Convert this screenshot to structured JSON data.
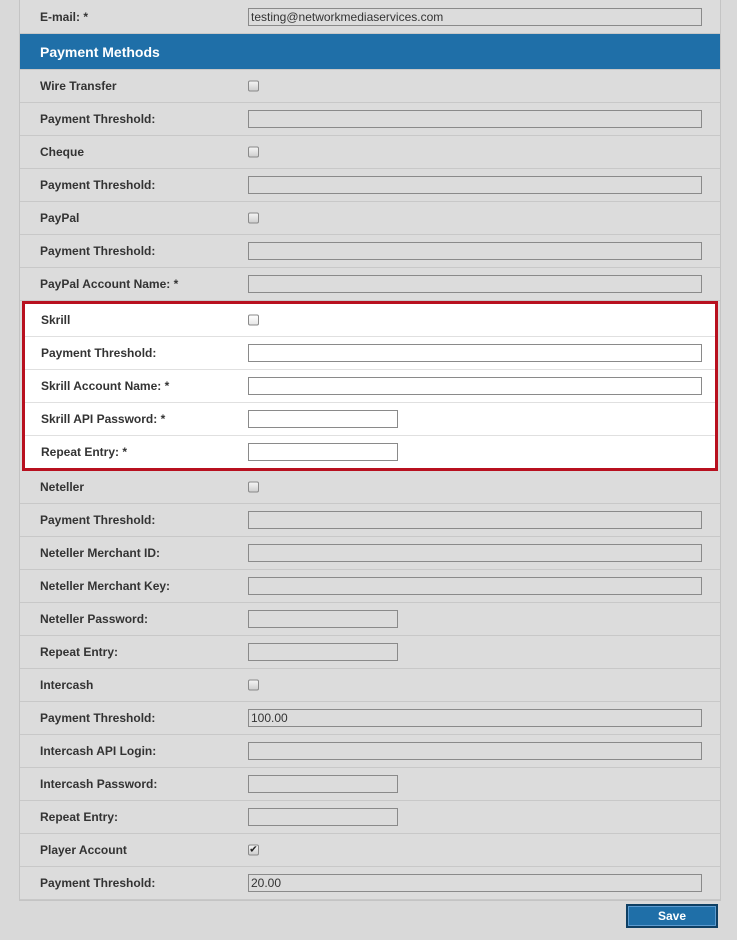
{
  "email": {
    "label": "E-mail: *",
    "value": "testing@networkmediaservices.com"
  },
  "section_title": "Payment Methods",
  "rows_before": [
    {
      "label": "Wire Transfer",
      "type": "checkbox",
      "checked": false
    },
    {
      "label": "Payment Threshold:",
      "type": "wide",
      "value": ""
    },
    {
      "label": "Cheque",
      "type": "checkbox",
      "checked": false
    },
    {
      "label": "Payment Threshold:",
      "type": "wide",
      "value": ""
    },
    {
      "label": "PayPal",
      "type": "checkbox",
      "checked": false
    },
    {
      "label": "Payment Threshold:",
      "type": "wide",
      "value": ""
    },
    {
      "label": "PayPal Account Name: *",
      "type": "wide",
      "value": ""
    }
  ],
  "skrill_rows": [
    {
      "label": "Skrill",
      "type": "checkbox",
      "checked": false
    },
    {
      "label": "Payment Threshold:",
      "type": "wide",
      "value": ""
    },
    {
      "label": "Skrill Account Name: *",
      "type": "wide",
      "value": ""
    },
    {
      "label": "Skrill API Password: *",
      "type": "short",
      "value": ""
    },
    {
      "label": "Repeat Entry: *",
      "type": "short",
      "value": ""
    }
  ],
  "rows_after": [
    {
      "label": "Neteller",
      "type": "checkbox",
      "checked": false
    },
    {
      "label": "Payment Threshold:",
      "type": "wide",
      "value": ""
    },
    {
      "label": "Neteller Merchant ID:",
      "type": "wide",
      "value": ""
    },
    {
      "label": "Neteller Merchant Key:",
      "type": "wide",
      "value": ""
    },
    {
      "label": "Neteller Password:",
      "type": "short",
      "value": ""
    },
    {
      "label": "Repeat Entry:",
      "type": "short",
      "value": ""
    },
    {
      "label": "Intercash",
      "type": "checkbox",
      "checked": false
    },
    {
      "label": "Payment Threshold:",
      "type": "wide",
      "value": "100.00"
    },
    {
      "label": "Intercash API Login:",
      "type": "wide",
      "value": ""
    },
    {
      "label": "Intercash Password:",
      "type": "short",
      "value": ""
    },
    {
      "label": "Repeat Entry:",
      "type": "short",
      "value": ""
    },
    {
      "label": "Player Account",
      "type": "checkbox",
      "checked": true
    },
    {
      "label": "Payment Threshold:",
      "type": "wide",
      "value": "20.00"
    }
  ],
  "save_label": "Save"
}
